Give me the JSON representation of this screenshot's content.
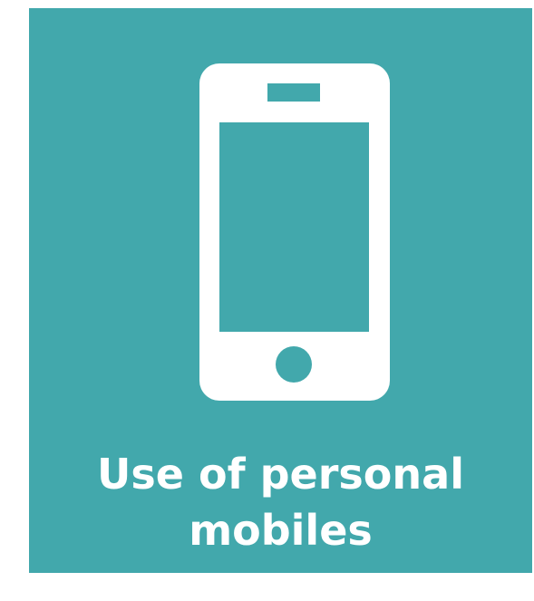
{
  "tile": {
    "background": "#42a8ac",
    "icon": "mobile-phone-icon",
    "caption_line1": "Use of personal",
    "caption_line2": "mobiles",
    "text_color": "#ffffff"
  }
}
